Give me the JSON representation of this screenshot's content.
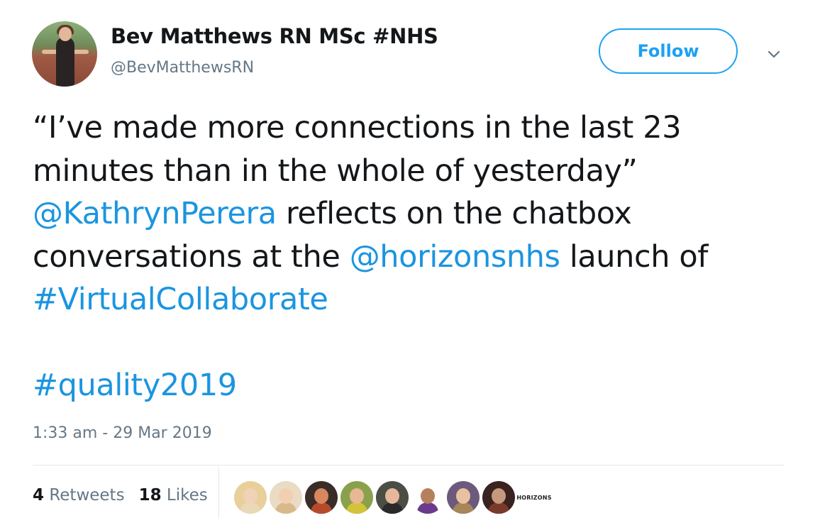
{
  "author": {
    "display_name": "Bev Matthews RN MSc #NHS",
    "handle": "@BevMatthewsRN"
  },
  "actions": {
    "follow_label": "Follow",
    "more_icon": "chevron-down-icon"
  },
  "tweet": {
    "segments": [
      {
        "text": "“I’ve made more connections in the last 23 minutes than in the whole of yesterday” ",
        "type": "text"
      },
      {
        "text": "@KathrynPerera",
        "type": "mention"
      },
      {
        "text": " reflects on the chatbox conversations at the ",
        "type": "text"
      },
      {
        "text": "@horizonsnhs",
        "type": "mention"
      },
      {
        "text": " launch of ",
        "type": "text"
      },
      {
        "text": "#VirtualCollaborate",
        "type": "hashtag"
      },
      {
        "text": "#quality2019",
        "type": "hashtag"
      }
    ],
    "timestamp": "1:33 am - 29 Mar 2019"
  },
  "stats": {
    "retweets_count": "4",
    "retweets_label": "Retweets",
    "likes_count": "18",
    "likes_label": "Likes"
  },
  "liked_by": {
    "logo_text": "HORIZONS",
    "avatars": [
      {
        "skin": "#f1d2b6",
        "bg": "#e9cf9a",
        "cloth": "#e8d9b8"
      },
      {
        "skin": "#f3cfb2",
        "bg": "#eadbc4",
        "cloth": "#d9b98c"
      },
      {
        "skin": "#d7885e",
        "bg": "#3a2c26",
        "cloth": "#b84a2c"
      },
      {
        "skin": "#e8b894",
        "bg": "#8aa14b",
        "cloth": "#d2c33a"
      },
      {
        "skin": "#e6b79a",
        "bg": "#4a4e44",
        "cloth": "#2a2a2a"
      },
      {
        "skin": "#b5805e",
        "bg": "#ffffff",
        "cloth": "#6a3a8c"
      },
      {
        "skin": "#e9c1a0",
        "bg": "#6c5a7c",
        "cloth": "#a8865a"
      },
      {
        "skin": "#c59a7c",
        "bg": "#3a2220",
        "cloth": "#7a3a2a"
      }
    ]
  }
}
